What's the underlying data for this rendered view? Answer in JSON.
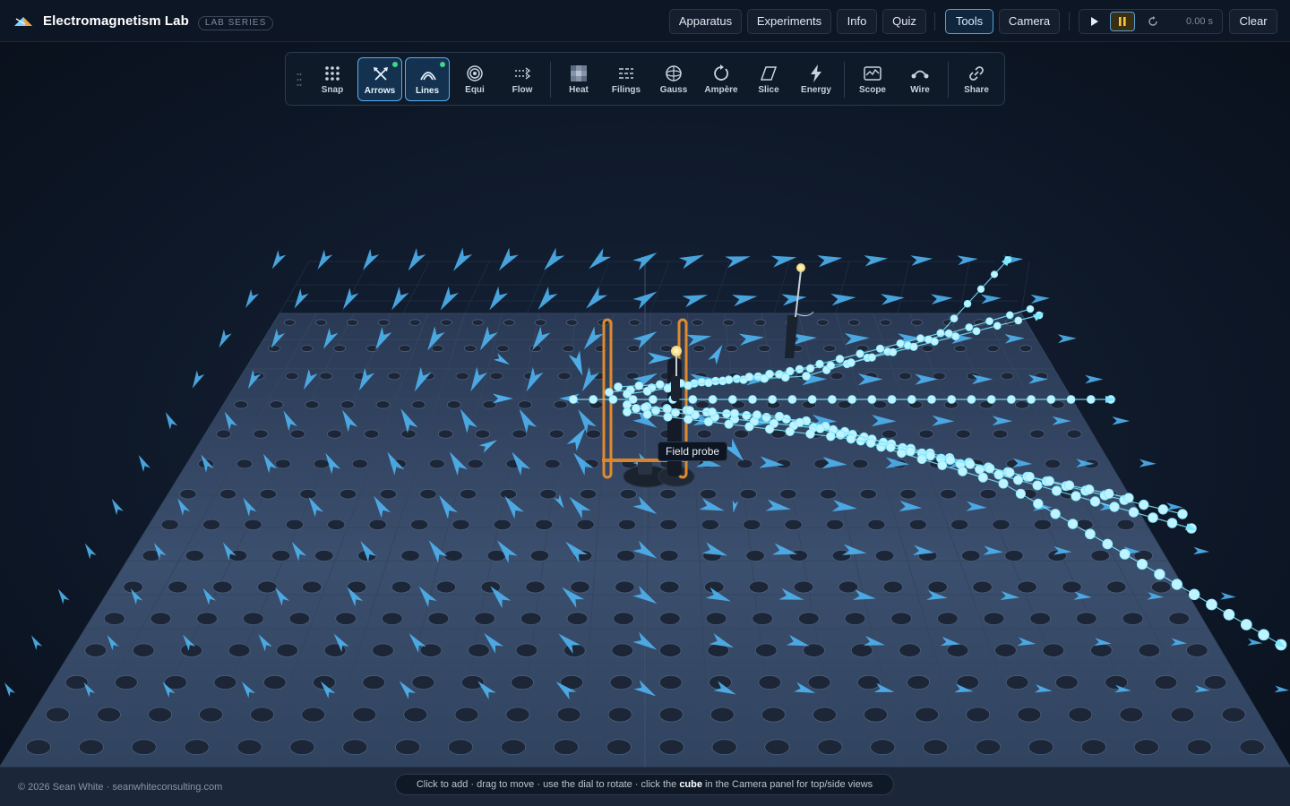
{
  "app": {
    "title": "Electromagnetism Lab",
    "badge": "LAB SERIES"
  },
  "nav": {
    "apparatus": "Apparatus",
    "experiments": "Experiments",
    "info": "Info",
    "quiz": "Quiz",
    "tools": "Tools",
    "camera": "Camera",
    "clear": "Clear",
    "active_tab": "Tools"
  },
  "transport": {
    "play_icon": "play-icon",
    "pause_icon": "pause-icon",
    "reset_icon": "reset-icon",
    "time": "0.00 s",
    "state": "paused"
  },
  "toolbar": {
    "tools": [
      {
        "label": "Snap",
        "icon": "snap-grid-icon",
        "active": false
      },
      {
        "label": "Arrows",
        "icon": "arrows-icon",
        "active": true
      },
      {
        "label": "Lines",
        "icon": "field-lines-icon",
        "active": true
      },
      {
        "label": "Equi",
        "icon": "equipotential-icon",
        "active": false
      },
      {
        "label": "Flow",
        "icon": "flow-icon",
        "active": false
      },
      {
        "label": "Heat",
        "icon": "heatmap-icon",
        "active": false
      },
      {
        "label": "Filings",
        "icon": "filings-icon",
        "active": false
      },
      {
        "label": "Gauss",
        "icon": "gauss-sphere-icon",
        "active": false
      },
      {
        "label": "Ampère",
        "icon": "ampere-loop-icon",
        "active": false
      },
      {
        "label": "Slice",
        "icon": "slice-plane-icon",
        "active": false
      },
      {
        "label": "Energy",
        "icon": "energy-bolt-icon",
        "active": false
      },
      {
        "label": "Scope",
        "icon": "scope-icon",
        "active": false
      },
      {
        "label": "Wire",
        "icon": "wire-icon",
        "active": false
      },
      {
        "label": "Share",
        "icon": "share-link-icon",
        "active": false
      }
    ]
  },
  "scene": {
    "probe_label": "Field probe",
    "colors": {
      "background": "#0b1422",
      "table": "#3a4d6a",
      "hole": "#1c2636",
      "arrow": "#4fb3f0",
      "field_line": "#7fe8ff",
      "coil": "#e08a2c",
      "probe_tip": "#fff2b3"
    }
  },
  "footer": {
    "copyright": "© 2026 Sean White · seanwhiteconsulting.com",
    "hint_part1": "Click to add · drag to move · use the dial to rotate · click the ",
    "hint_bold": "cube",
    "hint_part2": " in the Camera panel for top/side views"
  }
}
